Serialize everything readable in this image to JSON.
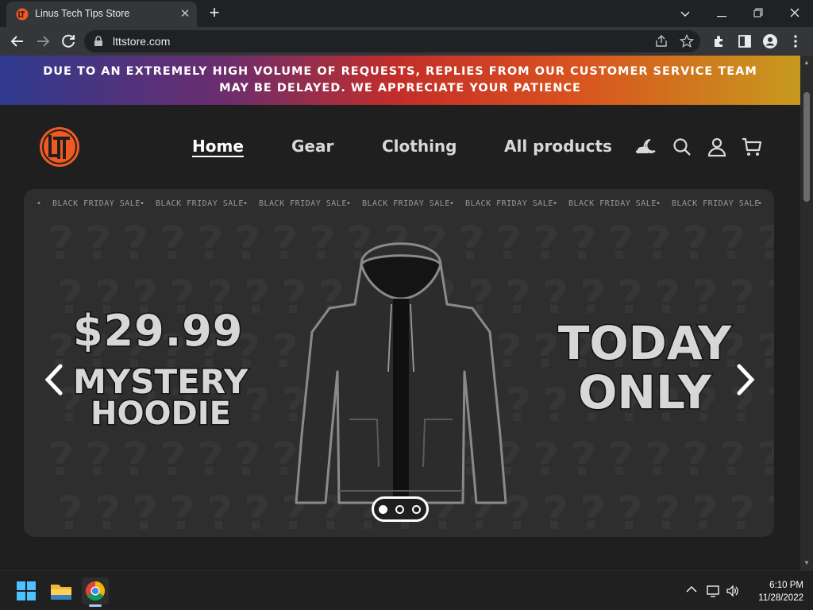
{
  "browser": {
    "tab_title": "Linus Tech Tips Store",
    "url": "lttstore.com"
  },
  "announcement": "DUE TO AN EXTREMELY HIGH VOLUME OF REQUESTS, REPLIES FROM OUR CUSTOMER SERVICE TEAM MAY BE DELAYED. WE APPRECIATE YOUR PATIENCE",
  "nav": {
    "home": "Home",
    "gear": "Gear",
    "clothing": "Clothing",
    "all_products": "All products"
  },
  "hero": {
    "ticker": [
      "BLACK FRIDAY SALE",
      "BLACK FRIDAY SALE",
      "BLACK FRIDAY SALE",
      "BLACK FRIDAY SALE",
      "BLACK FRIDAY SALE",
      "BLACK FRIDAY SALE",
      "BLACK FRIDAY SALE"
    ],
    "price": "$29.99",
    "line1": "MYSTERY",
    "line2": "HOODIE",
    "today": "TODAY ONLY",
    "active_slide": 1,
    "slide_count": 3
  },
  "taskbar": {
    "time": "6:10 PM",
    "date": "11/28/2022"
  },
  "colors": {
    "brand_orange": "#f05a22",
    "page_bg": "#1f1f1f",
    "hero_bg": "#2e2e2e"
  },
  "icons": {
    "header": [
      "theme-toggle-icon",
      "search-icon",
      "account-icon",
      "cart-icon"
    ],
    "browser_toolbar": [
      "back-icon",
      "forward-icon",
      "reload-icon",
      "lock-icon",
      "share-icon",
      "bookmark-star-icon",
      "extensions-icon",
      "side-panel-icon",
      "profile-icon",
      "menu-icon"
    ]
  }
}
